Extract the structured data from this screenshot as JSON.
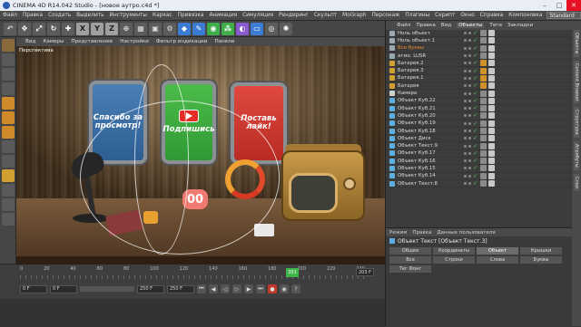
{
  "window": {
    "title": "CINEMA 4D R14.042 Studio - [новое аутро.c4d *]"
  },
  "menu": [
    "Файл",
    "Правка",
    "Создать",
    "Выделить",
    "Инструменты",
    "Каркас",
    "Привязка",
    "Анимация",
    "Симуляция",
    "Рендеринг",
    "Скульпт",
    "MoGraph",
    "Персонаж",
    "Плагины",
    "Скрипт",
    "Окно",
    "Справка",
    "Компоновка"
  ],
  "layout_value": "Standard",
  "toolbar_icons": [
    "undo-icon",
    "move-icon",
    "scale-icon",
    "rotate-icon",
    "add-icon",
    "x-axis-icon",
    "y-axis-icon",
    "z-axis-icon",
    "world-icon",
    "render-icon",
    "render-view-icon",
    "render-settings-icon",
    "cube-icon",
    "pen-icon",
    "subdivision-icon",
    "array-icon",
    "deformer-icon",
    "floor-icon",
    "camera-icon",
    "light-icon"
  ],
  "viewport": {
    "menu": [
      "Вид",
      "Камеры",
      "Представление",
      "Настройки",
      "Фильтр индикации",
      "Панели"
    ],
    "label": "Перспектива"
  },
  "scene": {
    "window1_text": "Спасибо за просмотр!",
    "window2_text": "Подпишись",
    "window3_text": "Поставь лайк!",
    "digit": "00"
  },
  "objects": {
    "tabs": [
      "Файл",
      "Правка",
      "Вид",
      "Объекты",
      "Теги",
      "Закладки"
    ],
    "active_tab": "Объекты",
    "items": [
      {
        "name": "Ноль объект",
        "icon": "null",
        "color": "#9aa"
      },
      {
        "name": "Ноль объект.1",
        "icon": "null",
        "color": "#9aa"
      },
      {
        "name": "Все буквы",
        "icon": "null",
        "color": "#e08a2a"
      },
      {
        "name": "атмо. LUSR",
        "icon": "null",
        "color": "#9aa"
      },
      {
        "name": "Батарея.2",
        "icon": "battery",
        "color": "#9aa"
      },
      {
        "name": "Батарея.3",
        "icon": "battery",
        "color": "#9aa"
      },
      {
        "name": "Батарея.1",
        "icon": "battery",
        "color": "#9aa"
      },
      {
        "name": "Батарея",
        "icon": "battery",
        "color": "#9aa"
      },
      {
        "name": "Камера",
        "icon": "camera",
        "color": "#9aa"
      },
      {
        "name": "Объект Куб.22",
        "icon": "cube",
        "color": "#9aa"
      },
      {
        "name": "Объект Куб.21",
        "icon": "cube",
        "color": "#9aa"
      },
      {
        "name": "Объект Куб.20",
        "icon": "cube",
        "color": "#9aa"
      },
      {
        "name": "Объект Куб.19",
        "icon": "cube",
        "color": "#9aa"
      },
      {
        "name": "Объект Куб.18",
        "icon": "cube",
        "color": "#9aa"
      },
      {
        "name": "Объект Диск",
        "icon": "disc",
        "color": "#9aa"
      },
      {
        "name": "Объект Текст.9",
        "icon": "text",
        "color": "#9aa"
      },
      {
        "name": "Объект Куб.17",
        "icon": "cube",
        "color": "#9aa"
      },
      {
        "name": "Объект Куб.16",
        "icon": "cube",
        "color": "#9aa"
      },
      {
        "name": "Объект Куб.15",
        "icon": "cube",
        "color": "#9aa"
      },
      {
        "name": "Объект Куб.14",
        "icon": "cube",
        "color": "#9aa"
      },
      {
        "name": "Объект Текст.8",
        "icon": "text",
        "color": "#9aa"
      }
    ]
  },
  "attributes": {
    "menu": [
      "Режим",
      "Правка",
      "Данные пользователя"
    ],
    "title": "Объект Текст [Объект Текст.3]",
    "tabs": [
      "Общее",
      "Координаты",
      "Объект",
      "Крышки",
      "Все",
      "Строки",
      "Слова",
      "Буквы",
      "Тег Фонг"
    ],
    "active_tab": "Объект"
  },
  "side_tabs": [
    "Объекты",
    "Content Browser",
    "Структура",
    "Атрибуты",
    "Слои"
  ],
  "timeline": {
    "ticks": [
      "0",
      "20",
      "40",
      "60",
      "80",
      "100",
      "120",
      "140",
      "160",
      "180",
      "200",
      "220",
      "240"
    ],
    "current_frame": "201",
    "end_frame": "203 F",
    "field_start": "0 F",
    "field_min": "0 F",
    "field_max": "250 F",
    "field_end": "250 F"
  }
}
